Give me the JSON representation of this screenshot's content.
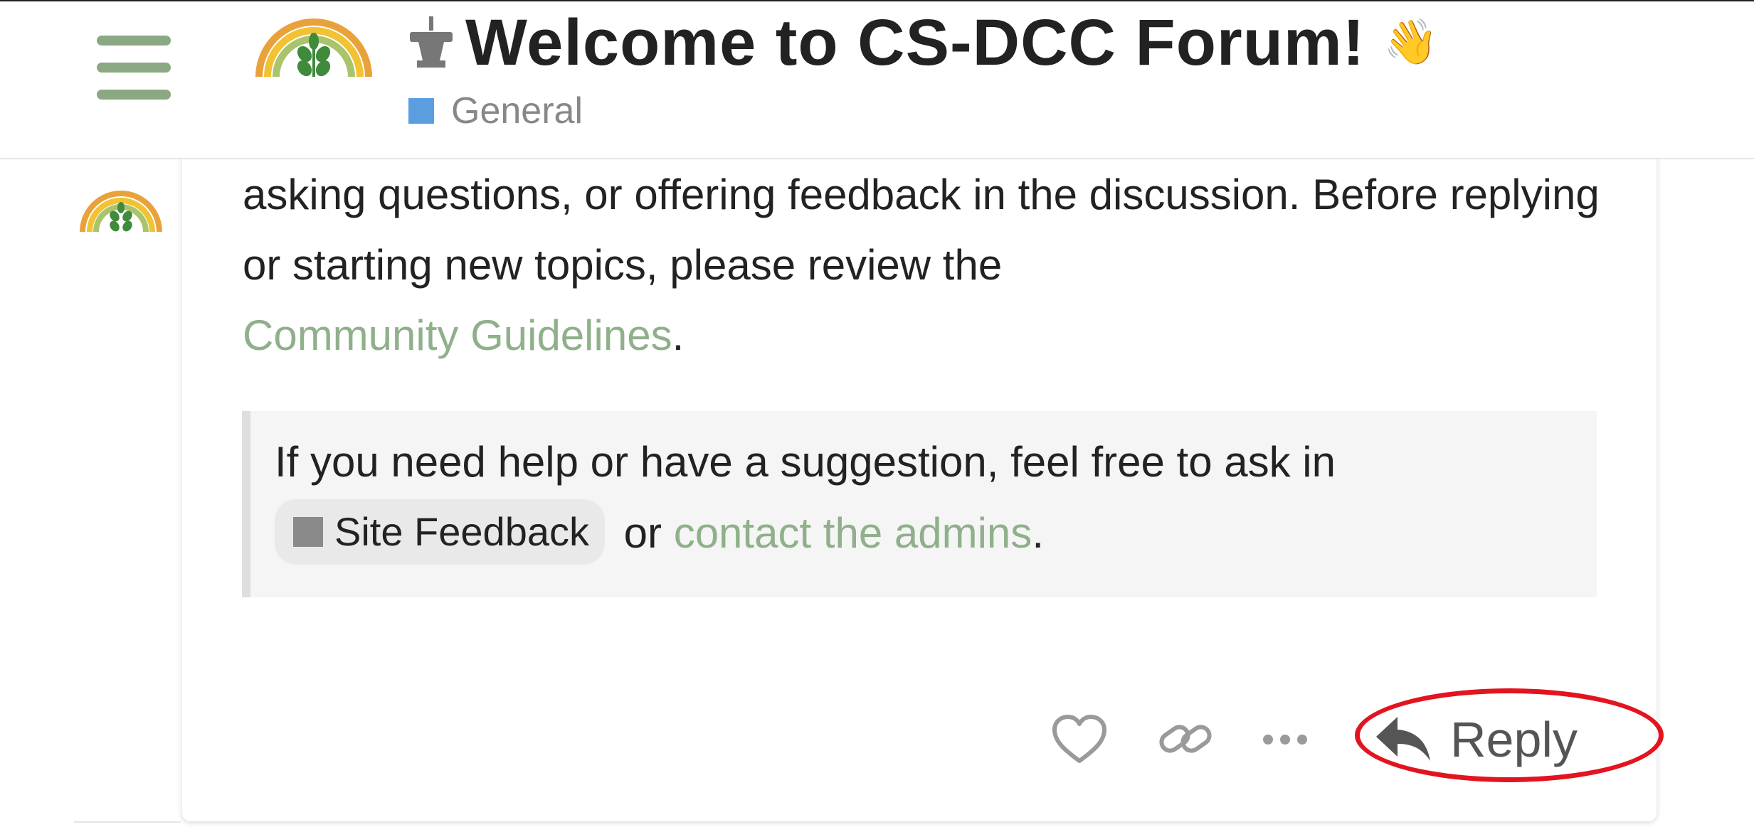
{
  "header": {
    "topic_title": "Welcome to CS-DCC Forum!",
    "category": {
      "label": "General",
      "color": "#5b9ee0"
    },
    "icons": {
      "menu": "hamburger-menu-icon",
      "pin": "pin-icon",
      "wave": "waving-hand-icon",
      "logo": "site-logo"
    }
  },
  "post": {
    "paragraph_1": "asking questions, or offering feedback in the discussion. Before replying or starting new topics, please review the ",
    "guidelines_link": "Community Guidelines",
    "paragraph_1_end": ".",
    "quote": {
      "text_before": "If you need help or have a suggestion, feel free to ask in",
      "badge_label": "Site Feedback",
      "text_or": " or ",
      "admins_link": "contact the admins",
      "text_end": "."
    }
  },
  "actions": {
    "like_icon": "heart-icon",
    "link_icon": "link-icon",
    "more_icon": "ellipsis-icon",
    "reply_icon": "reply-arrow-icon",
    "reply_label": "Reply"
  },
  "colors": {
    "accent_link": "#8fb08a",
    "menu": "#8aa882",
    "highlight": "#e3141f"
  }
}
